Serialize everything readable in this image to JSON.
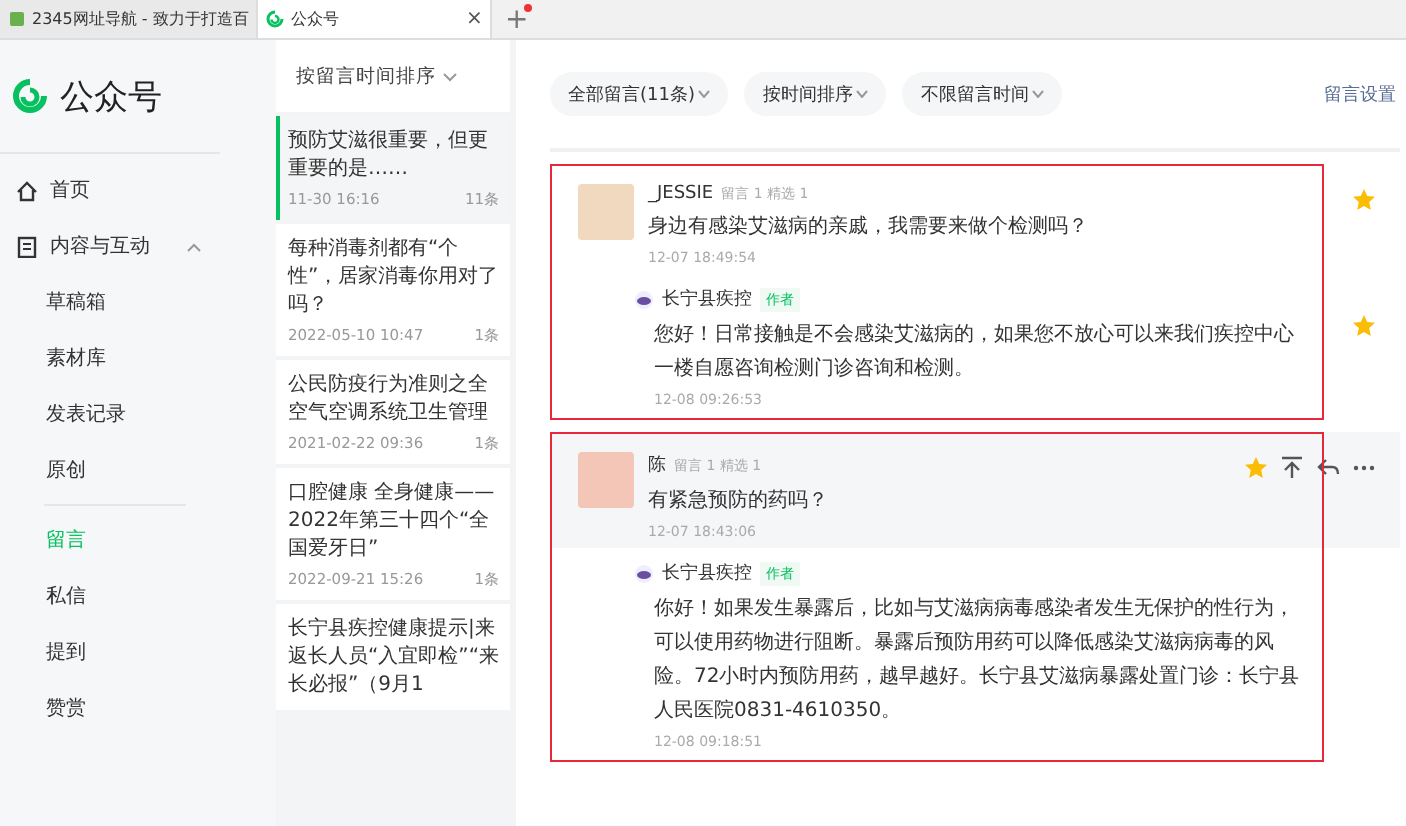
{
  "browser_tabs": [
    {
      "title": "2345网址导航 - 致力于打造百",
      "selected": false
    },
    {
      "title": "公众号",
      "selected": true,
      "close": "×"
    }
  ],
  "new_tab": {
    "label": "+",
    "notification_dot": true
  },
  "sidebar": {
    "logo_text": "公众号",
    "items": [
      {
        "label": "首页"
      },
      {
        "label": "内容与互动",
        "expanded": true,
        "children": [
          {
            "label": "草稿箱",
            "selected": false,
            "divider_before": false
          },
          {
            "label": "素材库",
            "selected": false,
            "divider_before": false
          },
          {
            "label": "发表记录",
            "selected": false,
            "divider_before": false
          },
          {
            "label": "原创",
            "selected": false,
            "divider_before": false
          },
          {
            "label": "留言",
            "selected": true,
            "divider_before": true
          },
          {
            "label": "私信",
            "selected": false,
            "divider_before": false
          },
          {
            "label": "提到",
            "selected": false,
            "divider_before": false
          },
          {
            "label": "赞赏",
            "selected": false,
            "divider_before": false
          }
        ]
      }
    ]
  },
  "articles": {
    "sort": "按留言时间排序",
    "items": [
      {
        "title": "预防艾滋很重要，但更重要的是……",
        "date": "11-30 16:16",
        "count": "11条",
        "selected": true
      },
      {
        "title": "每种消毒剂都有“个性”，居家消毒你用对了吗？",
        "date": "2022-05-10 10:47",
        "count": "1条",
        "selected": false
      },
      {
        "title": "公民防疫行为准则之全空气空调系统卫生管理",
        "date": "2021-02-22 09:36",
        "count": "1条",
        "selected": false
      },
      {
        "title": "口腔健康 全身健康——2022年第三十四个“全国爱牙日”",
        "date": "2022-09-21 15:26",
        "count": "1条",
        "selected": false
      },
      {
        "title": "长宁县疾控健康提示|来返长人员“入宜即检”“来长必报”（9月1",
        "selected": false
      }
    ]
  },
  "filters": [
    {
      "label": "全部留言(11条)"
    },
    {
      "label": "按时间排序"
    },
    {
      "label": "不限留言时间"
    }
  ],
  "settings_link": "留言设置",
  "comments": [
    {
      "author": "_JESSIE",
      "stats": "留言 1 精选 1",
      "text": "身边有感染艾滋病的亲戚，我需要来做个检测吗？",
      "time": "12-07 18:49:54",
      "starred": true,
      "hovered": false,
      "highlighted": true,
      "reply": {
        "author": "长宁县疾控",
        "badge": "作者",
        "text": "您好！日常接触是不会感染艾滋病的，如果您不放心可以来我们疾控中心一楼自愿咨询检测门诊咨询和检测。",
        "time": "12-08 09:26:53",
        "starred": true
      }
    },
    {
      "author": "陈",
      "stats": "留言 1 精选 1",
      "text": "有紧急预防的药吗？",
      "time": "12-07 18:43:06",
      "starred": true,
      "hovered": true,
      "highlighted": true,
      "reply": {
        "author": "长宁县疾控",
        "badge": "作者",
        "text": "你好！如果发生暴露后，比如与艾滋病病毒感染者发生无保护的性行为，可以使用药物进行阻断。暴露后预防用药可以降低感染艾滋病病毒的风险。72小时内预防用药，越早越好。长宁县艾滋病暴露处置门诊：长宁县人民医院0831-4610350。",
        "time": "12-08 09:18:51",
        "starred": false
      }
    }
  ]
}
